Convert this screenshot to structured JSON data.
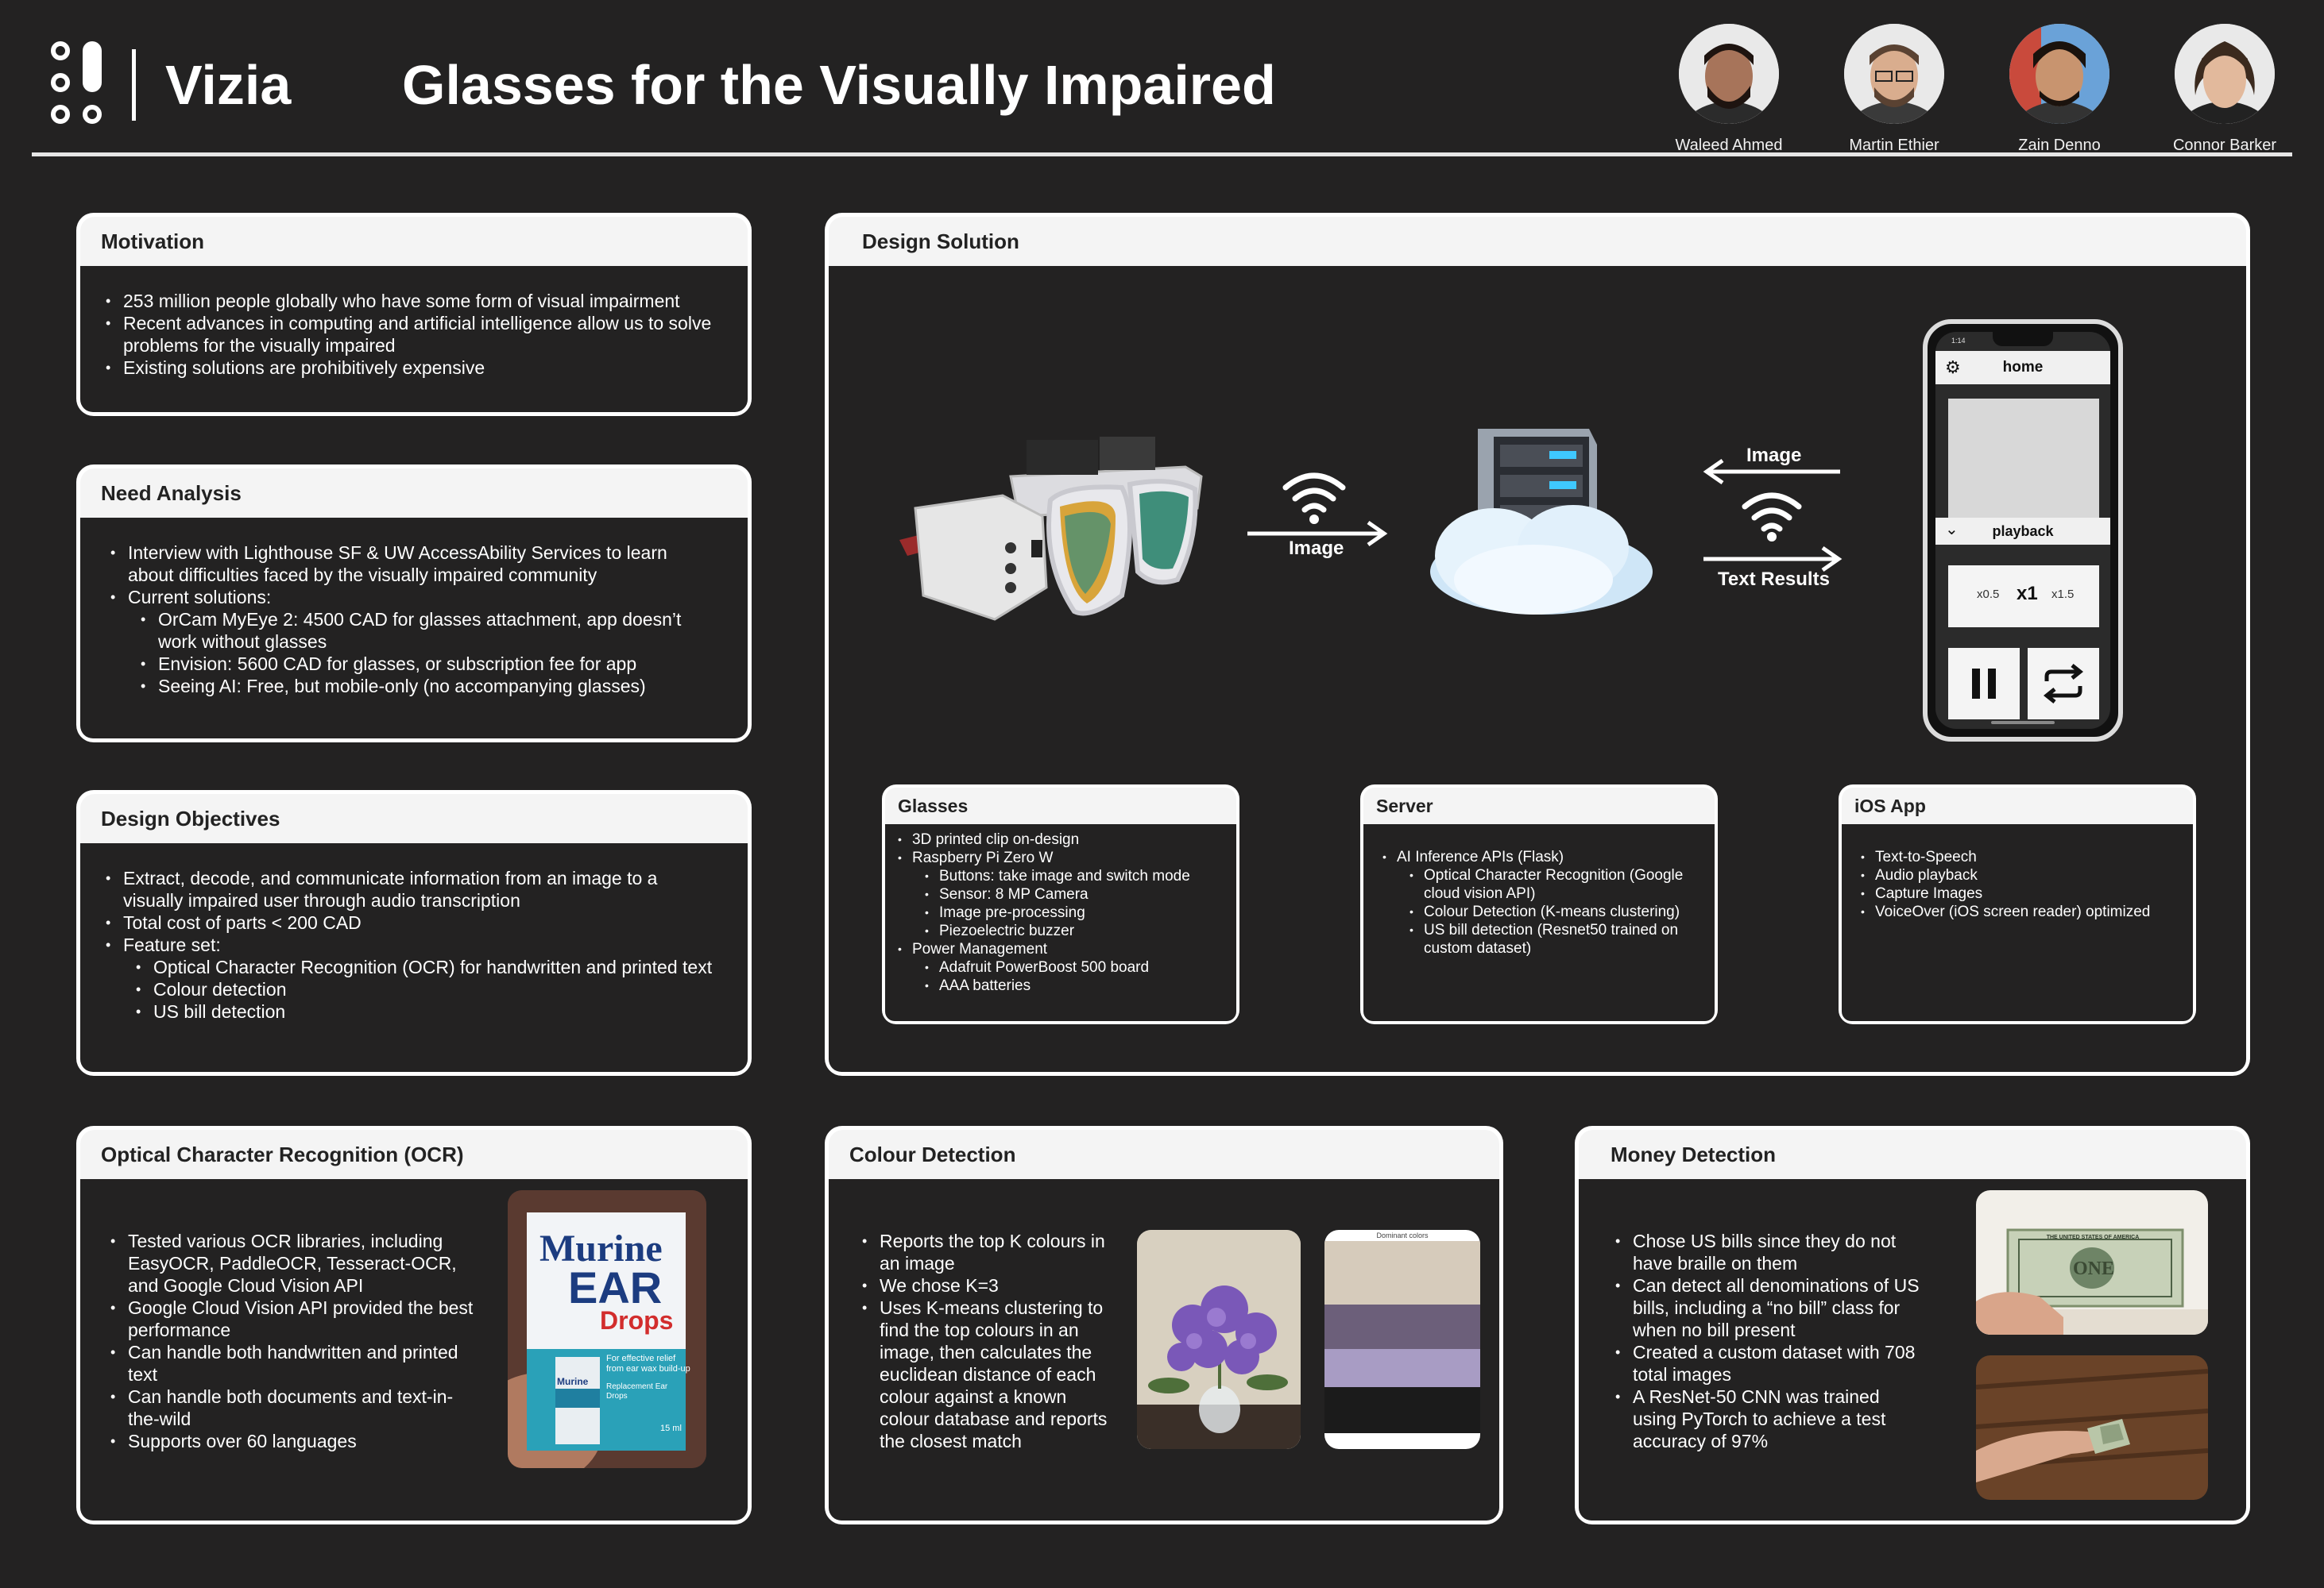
{
  "header": {
    "brand": "Vizia",
    "title": "Glasses for the Visually Impaired",
    "members": [
      {
        "name": "Waleed Ahmed",
        "skin": "#a7745a",
        "hair": "#1e1410"
      },
      {
        "name": "Martin Ethier",
        "skin": "#d9ad8e",
        "hair": "#5a4232"
      },
      {
        "name": "Zain Denno",
        "skin": "#c8946f",
        "hair": "#1a120d"
      },
      {
        "name": "Connor Barker",
        "skin": "#e2b99c",
        "hair": "#3b2a1e"
      }
    ]
  },
  "motivation": {
    "title": "Motivation",
    "items": [
      "253 million people globally who have some form of visual impairment",
      "Recent advances in computing and artificial intelligence allow us to solve problems for the visually impaired",
      "Existing solutions are prohibitively expensive"
    ]
  },
  "need": {
    "title": "Need Analysis",
    "items": [
      "Interview with Lighthouse SF & UW AccessAbility Services to learn about difficulties faced by the visually impaired community",
      "Current solutions:"
    ],
    "sub": [
      "OrCam MyEye 2: 4500 CAD for glasses attachment, app doesn’t work without glasses",
      "Envision: 5600 CAD for glasses, or subscription fee for app",
      "Seeing AI: Free, but mobile-only (no accompanying glasses)"
    ]
  },
  "objectives": {
    "title": "Design Objectives",
    "items": [
      "Extract, decode, and communicate information from an image to a visually impaired user through audio transcription",
      "Total cost of parts < 200 CAD",
      "Feature set:"
    ],
    "sub": [
      "Optical Character Recognition (OCR) for handwritten and printed text",
      "Colour detection",
      "US bill detection"
    ]
  },
  "solution": {
    "title": "Design Solution",
    "arrow_image_1": "Image",
    "arrow_image_2": "Image",
    "arrow_text_results": "Text Results",
    "phone": {
      "time": "1:14",
      "nav_title": "home",
      "playback_label": "playback",
      "speed_slow": "x0.5",
      "speed_normal": "x1",
      "speed_fast": "x1.5"
    },
    "glasses": {
      "title": "Glasses",
      "items": [
        "3D printed clip on-design",
        "Raspberry Pi Zero W"
      ],
      "pi_sub": [
        "Buttons: take image and switch mode",
        "Sensor: 8 MP Camera",
        "Image pre-processing",
        "Piezoelectric buzzer"
      ],
      "power": "Power Management",
      "power_sub": [
        "Adafruit PowerBoost 500 board",
        "AAA batteries"
      ]
    },
    "server": {
      "title": "Server",
      "item": "AI Inference APIs (Flask)",
      "sub": [
        "Optical Character Recognition (Google cloud vision API)",
        "Colour Detection (K-means clustering)",
        "US bill detection (Resnet50 trained on custom dataset)"
      ]
    },
    "ios": {
      "title": "iOS App",
      "items": [
        "Text-to-Speech",
        "Audio playback",
        "Capture Images",
        "VoiceOver (iOS screen reader) optimized"
      ]
    }
  },
  "ocr": {
    "title": "Optical Character Recognition (OCR)",
    "items": [
      "Tested various OCR libraries, including EasyOCR, PaddleOCR, Tesseract-OCR, and Google Cloud Vision API",
      "Google Cloud Vision API provided the best performance",
      "Can handle both handwritten and printed text",
      "Can handle both documents and text-in-the-wild",
      "Supports over 60 languages"
    ],
    "box_brand": "Murine",
    "box_product": "EAR",
    "box_drops": "Drops",
    "box_tagline": "For effective relief from ear wax build-up",
    "box_bottle": "Murine",
    "box_replacement": "Replacement Ear Drops",
    "box_volume": "15 ml"
  },
  "colour": {
    "title": "Colour Detection",
    "items": [
      "Reports the top K colours in an image",
      "We chose K=3",
      "Uses K-means clustering to find the top colours in an image, then calculates the euclidean distance of each colour against a known colour database and reports the closest match"
    ],
    "dominant_label": "Dominant colors",
    "swatches": [
      "#d6cbbb",
      "#6c5f7a",
      "#a89cc4",
      "#1b1b1b"
    ]
  },
  "money": {
    "title": "Money Detection",
    "items": [
      "Chose US bills since they do not have braille on them",
      "Can detect all denominations of US bills, including a “no bill” class for when no bill present",
      "Created a custom dataset with 708 total images",
      "A ResNet-50 CNN was trained using PyTorch to achieve a test accuracy of 97%"
    ],
    "bill_header": "THE UNITED STATES OF AMERICA",
    "bill_word": "ONE"
  }
}
